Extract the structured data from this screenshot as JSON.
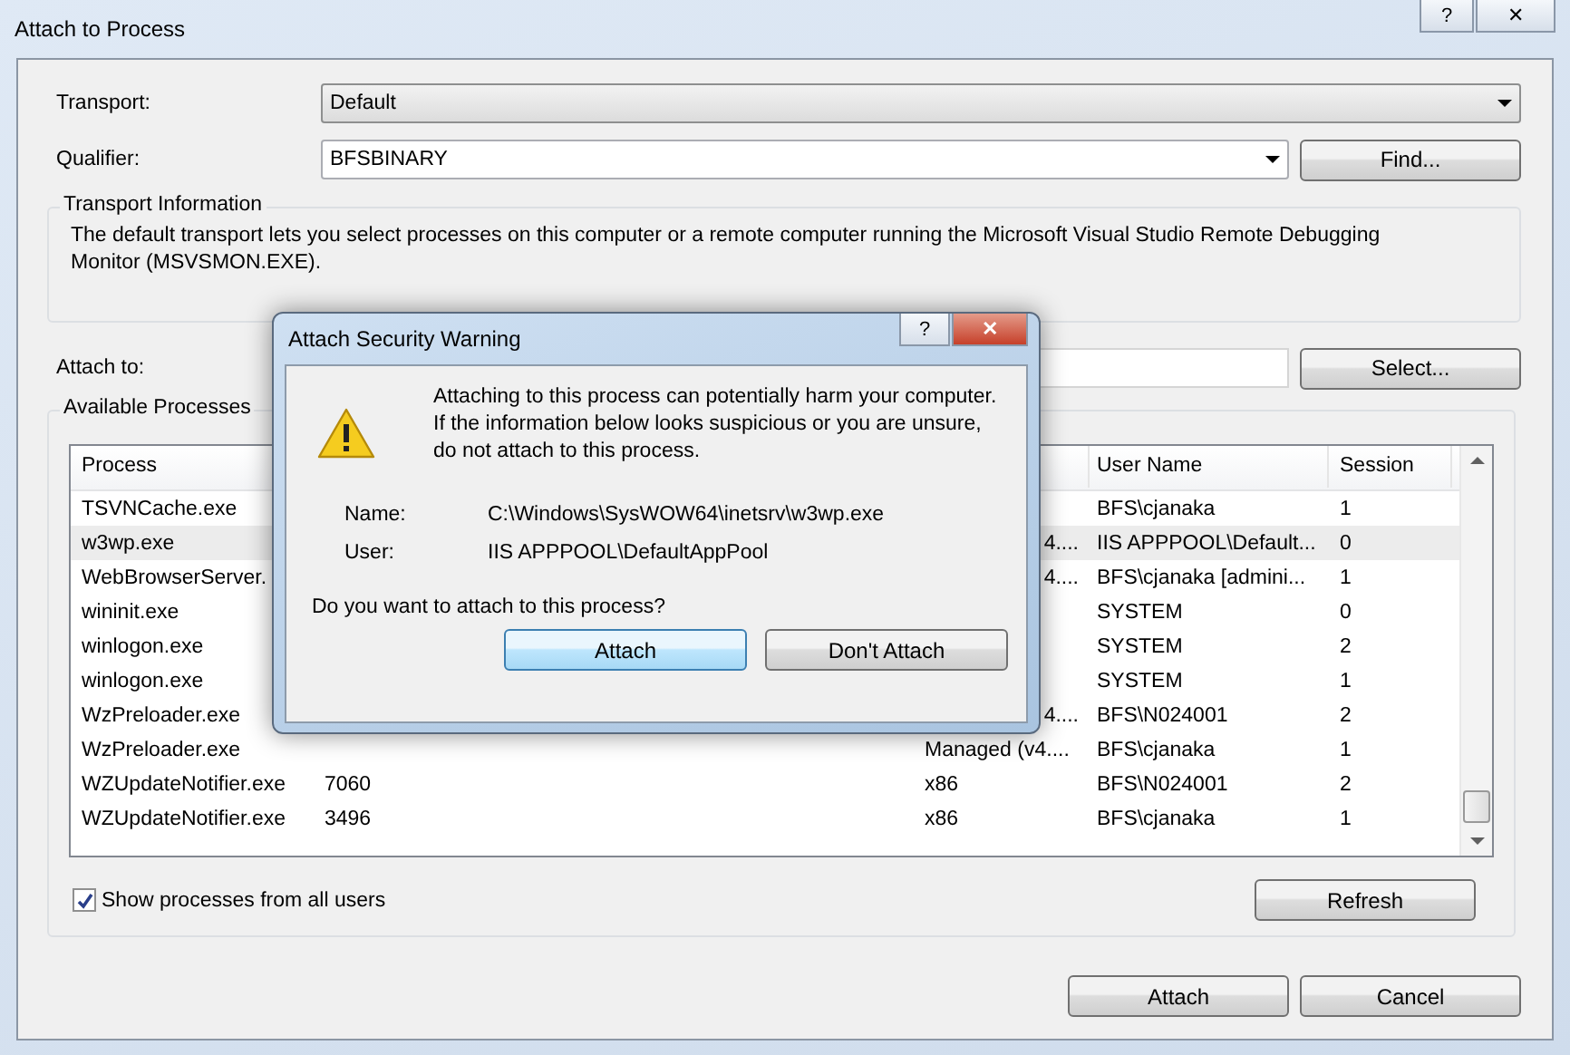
{
  "window": {
    "title": "Attach to Process",
    "help_button": "?",
    "close_button": "✕"
  },
  "transport": {
    "label": "Transport:",
    "value": "Default"
  },
  "qualifier": {
    "label": "Qualifier:",
    "value": "BFSBINARY",
    "find_button": "Find..."
  },
  "transport_information": {
    "title": "Transport Information",
    "text": "The default transport lets you select processes on this computer or a remote computer running the Microsoft Visual Studio Remote Debugging Monitor (MSVSMON.EXE)."
  },
  "attach_to": {
    "label": "Attach to:",
    "select_button": "Select..."
  },
  "available_processes": {
    "title": "Available Processes",
    "table": {
      "columns": [
        "Process",
        "User Name",
        "Session"
      ],
      "rows": [
        {
          "process": "TSVNCache.exe",
          "user": "BFS\\cjanaka",
          "session": "1",
          "selected": false
        },
        {
          "process": "w3wp.exe",
          "type": "4....",
          "type_cut": true,
          "user": "IIS APPPOOL\\Default...",
          "session": "0",
          "selected": true
        },
        {
          "process": "WebBrowserServer.",
          "type": "4....",
          "type_cut": true,
          "user": "BFS\\cjanaka [admini...",
          "session": "1",
          "selected": false
        },
        {
          "process": "wininit.exe",
          "user": "SYSTEM",
          "session": "0",
          "selected": false
        },
        {
          "process": "winlogon.exe",
          "user": "SYSTEM",
          "session": "2",
          "selected": false
        },
        {
          "process": "winlogon.exe",
          "user": "SYSTEM",
          "session": "1",
          "selected": false
        },
        {
          "process": "WzPreloader.exe",
          "type": "4....",
          "type_cut": true,
          "user": "BFS\\N024001",
          "session": "2",
          "selected": false
        },
        {
          "process": "WzPreloader.exe",
          "type": "Managed (v4....",
          "type_cut": false,
          "user": "BFS\\cjanaka",
          "session": "1",
          "selected": false
        },
        {
          "process": "WZUpdateNotifier.exe",
          "id": "7060",
          "type": "x86",
          "type_cut": false,
          "user": "BFS\\N024001",
          "session": "2",
          "selected": false
        },
        {
          "process": "WZUpdateNotifier.exe",
          "id": "3496",
          "type": "x86",
          "type_cut": false,
          "user": "BFS\\cjanaka",
          "session": "1",
          "selected": false
        }
      ]
    },
    "show_all_users": {
      "label": "Show processes from all users",
      "checked": true
    },
    "refresh_button": "Refresh"
  },
  "buttons": [
    "Attach",
    "Cancel"
  ],
  "warning_dialog": {
    "title": "Attach Security Warning",
    "help_button": "?",
    "close_button": "✕",
    "message": "Attaching to this process can potentially harm your computer. If the information below looks suspicious or you are unsure, do not attach to this process.",
    "details": [
      {
        "label": "Name:",
        "value": "C:\\Windows\\SysWOW64\\inetsrv\\w3wp.exe"
      },
      {
        "label": "User:",
        "value": "IIS APPPOOL\\DefaultAppPool"
      }
    ],
    "question": "Do you want to attach to this process?",
    "buttons": [
      {
        "label": "Attach",
        "default": true
      },
      {
        "label": "Don't Attach",
        "default": false
      }
    ]
  }
}
